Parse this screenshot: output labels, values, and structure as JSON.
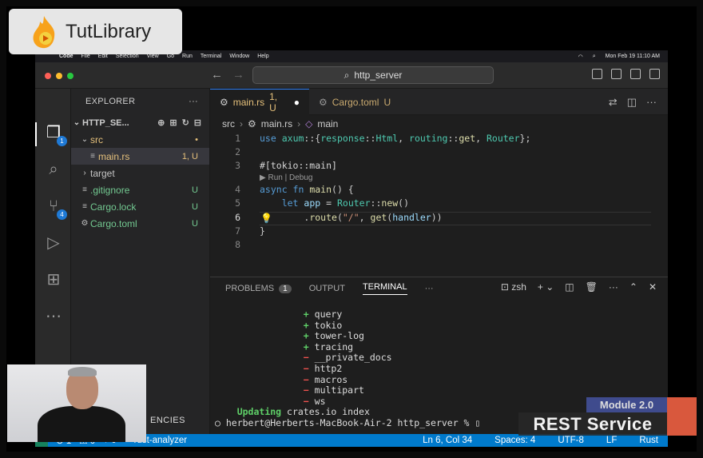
{
  "mac_menu": {
    "app": "Code",
    "items": [
      "File",
      "Edit",
      "Selection",
      "View",
      "Go",
      "Run",
      "Terminal",
      "Window",
      "Help"
    ],
    "clock": "Mon Feb 19  11:10 AM"
  },
  "titlebar": {
    "search_text": "http_server"
  },
  "activity": {
    "explorer_badge": "1",
    "scm_badge": "4"
  },
  "explorer": {
    "title": "EXPLORER",
    "project": "HTTP_SE...",
    "rows": [
      {
        "name": "src",
        "indent": 1,
        "status": "•",
        "color": "#e5c07b",
        "kind": "folder-open"
      },
      {
        "name": "main.rs",
        "indent": 2,
        "status": "1, U",
        "color": "#e5c07b",
        "kind": "file",
        "selected": true
      },
      {
        "name": "target",
        "indent": 1,
        "status": "",
        "color": "#c5c5c5",
        "kind": "folder"
      },
      {
        "name": ".gitignore",
        "indent": 1,
        "status": "U",
        "color": "#73c991",
        "kind": "file"
      },
      {
        "name": "Cargo.lock",
        "indent": 1,
        "status": "U",
        "color": "#73c991",
        "kind": "file"
      },
      {
        "name": "Cargo.toml",
        "indent": 1,
        "status": "U",
        "color": "#73c991",
        "kind": "file"
      }
    ],
    "dependencies_fragment": "ENCIES"
  },
  "tabs": [
    {
      "label": "main.rs",
      "status": "1, U",
      "active": true
    },
    {
      "label": "Cargo.toml",
      "status": "U",
      "active": false
    }
  ],
  "breadcrumb": {
    "folder": "src",
    "file": "main.rs",
    "symbol": "main"
  },
  "editor": {
    "line_numbers": [
      "1",
      "2",
      "3",
      "4",
      "5",
      "6",
      "7",
      "8"
    ],
    "codelens": "▶ Run | Debug"
  },
  "panel": {
    "tabs": [
      "PROBLEMS",
      "OUTPUT",
      "TERMINAL"
    ],
    "problems_count": "1",
    "shell": "zsh",
    "added": [
      "query",
      "tokio",
      "tower-log",
      "tracing"
    ],
    "removed": [
      "__private_docs",
      "http2",
      "macros",
      "multipart",
      "ws"
    ],
    "updating_label": "Updating",
    "updating_text": "crates.io index",
    "prompt": "herbert@Herberts-MacBook-Air-2 http_server % "
  },
  "statusbar": {
    "errors": "⊗ 1",
    "warnings": "⚠ 0",
    "ports": "⑂ 0",
    "analyzer": "rust-analyzer",
    "position": "Ln 6, Col 34",
    "spaces": "Spaces: 4",
    "encoding": "UTF-8",
    "eol": "LF",
    "language": "Rust"
  },
  "overlay": {
    "logo_text": "TutLibrary",
    "module": "Module 2.0",
    "rest": "REST Service"
  }
}
